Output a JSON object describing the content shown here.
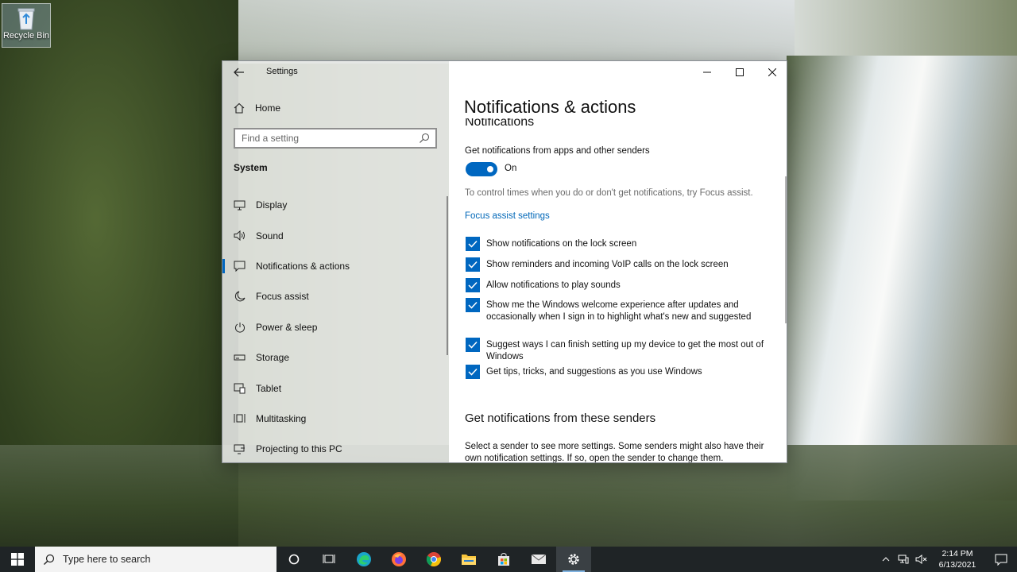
{
  "desktop": {
    "recycle_bin_label": "Recycle Bin"
  },
  "window": {
    "app_title": "Settings",
    "home_label": "Home",
    "search_placeholder": "Find a setting",
    "group_heading": "System",
    "nav": [
      {
        "label": "Display",
        "icon": "display-icon"
      },
      {
        "label": "Sound",
        "icon": "sound-icon"
      },
      {
        "label": "Notifications & actions",
        "icon": "notifications-icon",
        "active": true
      },
      {
        "label": "Focus assist",
        "icon": "moon-icon"
      },
      {
        "label": "Power & sleep",
        "icon": "power-icon"
      },
      {
        "label": "Storage",
        "icon": "storage-icon"
      },
      {
        "label": "Tablet",
        "icon": "tablet-icon"
      },
      {
        "label": "Multitasking",
        "icon": "multitasking-icon"
      },
      {
        "label": "Projecting to this PC",
        "icon": "projecting-icon"
      }
    ]
  },
  "content": {
    "page_title": "Notifications & actions",
    "section_heading": "Notifications",
    "get_notifications_label": "Get notifications from apps and other senders",
    "toggle_state": "On",
    "focus_hint": "To control times when you do or don't get notifications, try Focus assist.",
    "focus_link": "Focus assist settings",
    "checkboxes": [
      "Show notifications on the lock screen",
      "Show reminders and incoming VoIP calls on the lock screen",
      "Allow notifications to play sounds",
      "Show me the Windows welcome experience after updates and occasionally when I sign in to highlight what's new and suggested",
      "Suggest ways I can finish setting up my device to get the most out of Windows",
      "Get tips, tricks, and suggestions as you use Windows"
    ],
    "senders_heading": "Get notifications from these senders",
    "senders_desc": "Select a sender to see more settings. Some senders might also have their own notification settings. If so, open the sender to change them."
  },
  "taskbar": {
    "search_placeholder": "Type here to search",
    "time": "2:14 PM",
    "date": "6/13/2021"
  },
  "colors": {
    "accent": "#0067c0",
    "link": "#0067b8",
    "taskbar": "#1f2426"
  }
}
